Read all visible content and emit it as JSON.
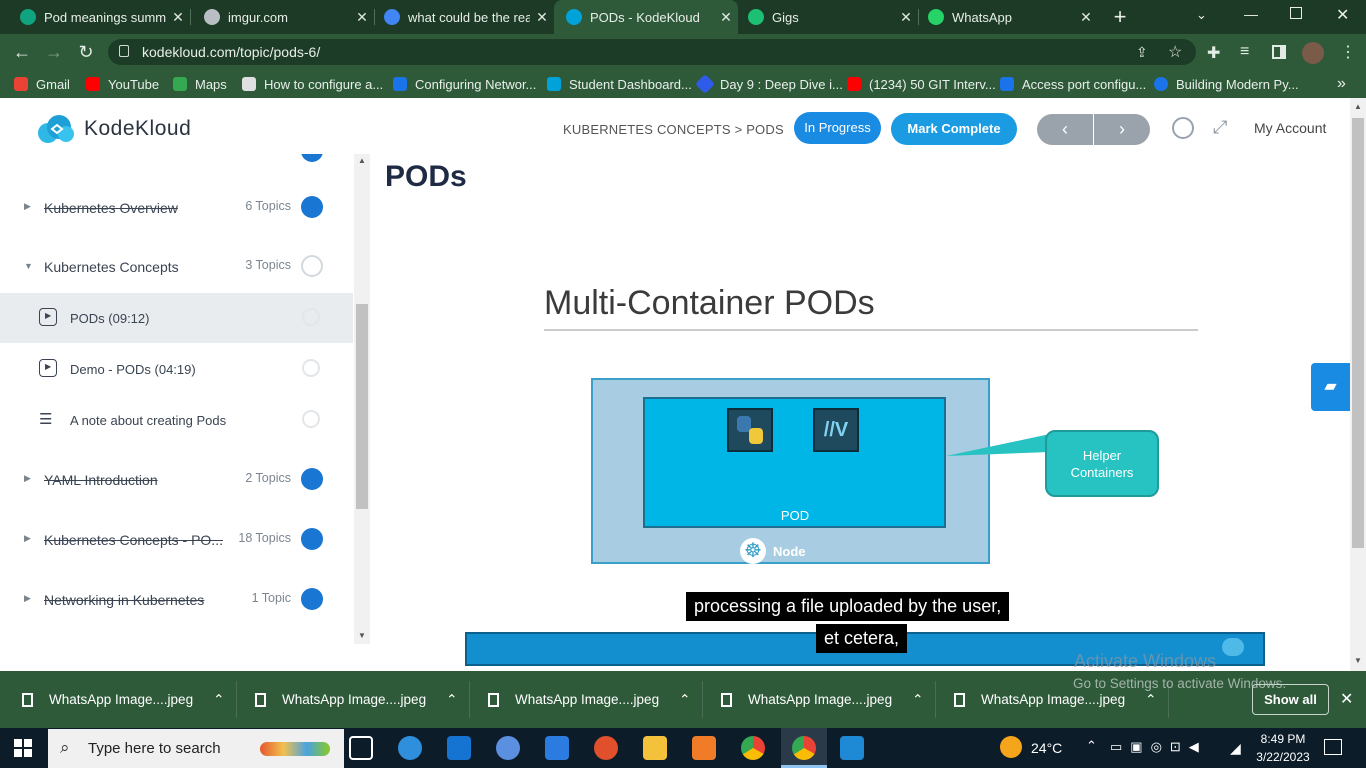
{
  "browser": {
    "tabs": [
      {
        "title": "Pod meanings summa",
        "color": "#10a37f"
      },
      {
        "title": "imgur.com",
        "color": "#b8bec3"
      },
      {
        "title": "what could be the rea",
        "color": "#4285f4"
      },
      {
        "title": "PODs - KodeKloud",
        "color": "#00a3d9"
      },
      {
        "title": "Gigs",
        "color": "#1dbf73"
      },
      {
        "title": "WhatsApp",
        "color": "#25d366"
      }
    ],
    "new_tab_label": "+",
    "url": "kodekloud.com/topic/pods-6/",
    "bookmarks": [
      {
        "label": "Gmail",
        "color": "#ea4335"
      },
      {
        "label": "YouTube",
        "color": "#ff0000"
      },
      {
        "label": "Maps",
        "color": "#34a853"
      },
      {
        "label": "How to configure a...",
        "color": "#e0e0e0"
      },
      {
        "label": "Configuring Networ...",
        "color": "#1a73e8"
      },
      {
        "label": "Student Dashboard...",
        "color": "#00a3d9"
      },
      {
        "label": "Day 9 : Deep Dive i...",
        "color": "#2f5bea"
      },
      {
        "label": "(1234) 50 GIT Interv...",
        "color": "#ff0000"
      },
      {
        "label": "Access port configu...",
        "color": "#1a73e8"
      },
      {
        "label": "Building Modern Py...",
        "color": "#1a73e8"
      }
    ],
    "bookmarks_more": "»"
  },
  "site": {
    "logo_text": "KodeKloud",
    "breadcrumb": "KUBERNETES CONCEPTS > PODS",
    "status_button": "In Progress",
    "complete_button": "Mark Complete",
    "prev_label": "‹",
    "next_label": "›",
    "account_label": "My Account"
  },
  "sidebar": {
    "lessons": [
      {
        "name": "Kubernetes Overview",
        "count": "6 Topics",
        "done": true
      },
      {
        "name": "Kubernetes Concepts",
        "count": "3 Topics",
        "done": false
      },
      {
        "name": "YAML Introduction",
        "count": "2 Topics",
        "done": true
      },
      {
        "name": "Kubernetes Concepts - PO...",
        "count": "18 Topics",
        "done": true
      },
      {
        "name": "Networking in Kubernetes",
        "count": "1 Topic",
        "done": true
      }
    ],
    "topics": [
      {
        "name": "PODs (09:12)",
        "kind": "video"
      },
      {
        "name": "Demo - PODs (04:19)",
        "kind": "video"
      },
      {
        "name": "A note about creating Pods",
        "kind": "text"
      }
    ]
  },
  "content": {
    "page_title": "PODs",
    "slide": {
      "title": "Multi-Container PODs",
      "pod_label": "POD",
      "node_label": "Node",
      "helper_label_1": "Helper",
      "helper_label_2": "Containers"
    },
    "caption_line_1": "processing a file uploaded by the user,",
    "caption_line_2": "et cetera,",
    "watermark_1": "Activate Windows",
    "watermark_2": "Go to Settings to activate Windows."
  },
  "downloads": {
    "items": [
      "WhatsApp Image....jpeg",
      "WhatsApp Image....jpeg",
      "WhatsApp Image....jpeg",
      "WhatsApp Image....jpeg",
      "WhatsApp Image....jpeg"
    ],
    "show_all": "Show all"
  },
  "taskbar": {
    "search_placeholder": "Type here to search",
    "weather": "24°C",
    "time": "8:49 PM",
    "date": "3/22/2023"
  }
}
